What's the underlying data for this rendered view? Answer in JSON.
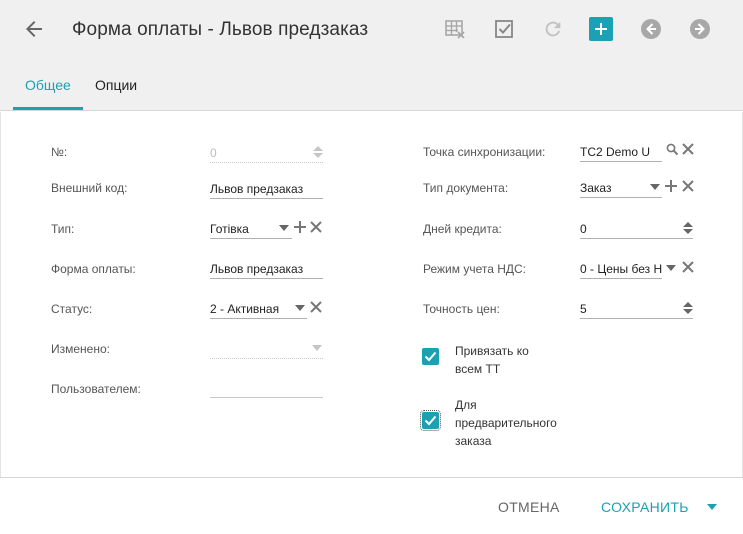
{
  "header": {
    "title": "Форма оплаты - Львов предзаказ"
  },
  "tabs": [
    {
      "label": "Общее",
      "active": true
    },
    {
      "label": "Опции",
      "active": false
    }
  ],
  "left_form": {
    "number": {
      "label": "№:",
      "value": "0"
    },
    "external_code": {
      "label": "Внешний код:",
      "value": "Львов предзаказ"
    },
    "type": {
      "label": "Тип:",
      "value": "Готівка"
    },
    "payment_form": {
      "label": "Форма оплаты:",
      "value": "Львов предзаказ"
    },
    "status": {
      "label": "Статус:",
      "value": "2 - Активная"
    },
    "changed": {
      "label": "Изменено:",
      "value": ""
    },
    "by_user": {
      "label": "Пользователем:",
      "value": ""
    }
  },
  "right_form": {
    "sync_point": {
      "label": "Точка синхронизации:",
      "value": "TC2 Demo U"
    },
    "doc_type": {
      "label": "Тип документа:",
      "value": "Заказ"
    },
    "credit_days": {
      "label": "Дней кредита:",
      "value": "0"
    },
    "vat_mode": {
      "label": "Режим учета НДС:",
      "value": "0 - Цены без Н"
    },
    "price_precision": {
      "label": "Точность цен:",
      "value": "5"
    }
  },
  "checkboxes": [
    {
      "label_line1": "Привязать ко",
      "label_line2": "всем ТТ",
      "checked": true
    },
    {
      "label_line1": "Для",
      "label_line2": "предварительного",
      "label_line3": "заказа",
      "checked": true
    }
  ],
  "footer": {
    "cancel_label": "ОТМЕНА",
    "save_label": "СОХРАНИТЬ"
  },
  "colors": {
    "accent": "#1ba1b3",
    "header_bg": "#f0f0f0",
    "icon_gray": "#a8a8a8"
  },
  "icons": [
    "back-arrow-icon",
    "table-clear-icon",
    "checkbox-check-icon",
    "refresh-icon",
    "add-icon",
    "prev-icon",
    "next-icon"
  ]
}
